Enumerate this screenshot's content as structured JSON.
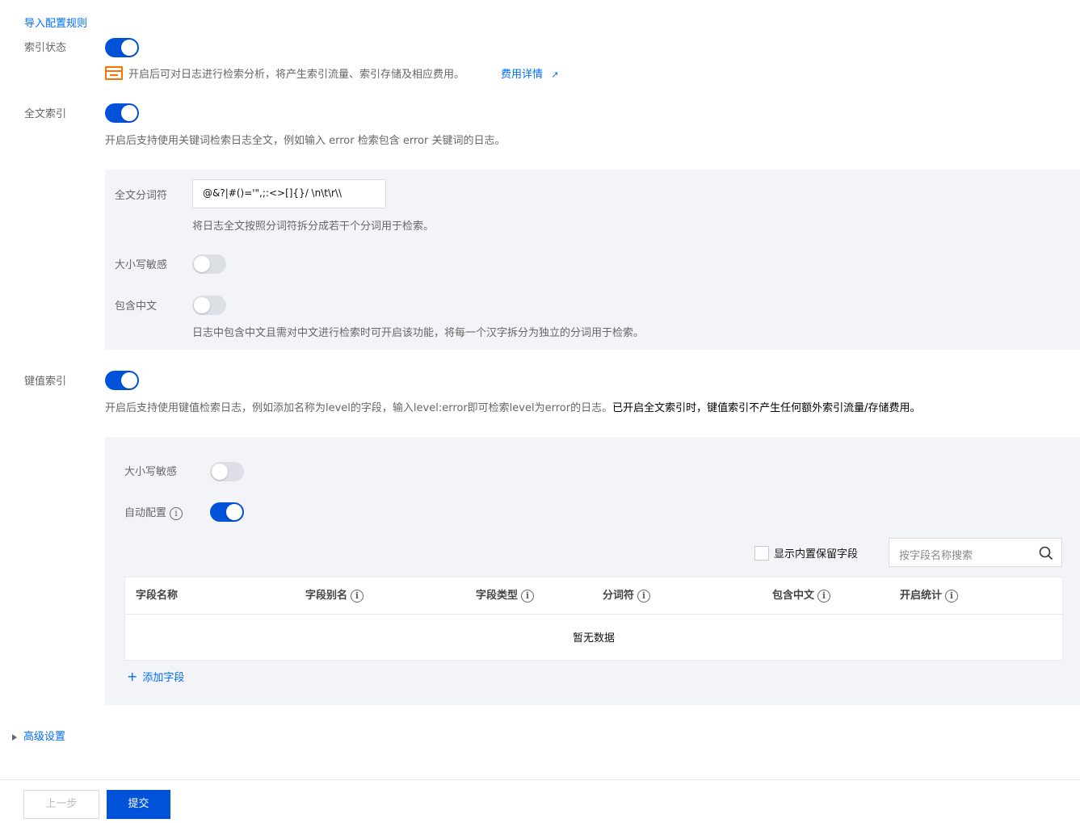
{
  "import_rules_link": "导入配置规则",
  "index_status": {
    "label": "索引状态",
    "enabled": true,
    "notice_text": "开启后可对日志进行检索分析，将产生索引流量、索引存储及相应费用。",
    "fee_link": "费用详情"
  },
  "fulltext_index": {
    "label": "全文索引",
    "enabled": true,
    "desc": "开启后支持使用关键词检索日志全文，例如输入 error 检索包含 error 关键词的日志。",
    "delimiter_label": "全文分词符",
    "delimiter_value": "@&?|#()='\",;:<>[]{}/ \\n\\t\\r\\\\",
    "delimiter_desc": "将日志全文按照分词符拆分成若干个分词用于检索。",
    "case_sensitive_label": "大小写敏感",
    "case_sensitive": false,
    "include_chinese_label": "包含中文",
    "include_chinese": false,
    "include_chinese_desc": "日志中包含中文且需对中文进行检索时可开启该功能，将每一个汉字拆分为独立的分词用于检索。"
  },
  "kv_index": {
    "label": "键值索引",
    "enabled": true,
    "desc_normal": "开启后支持使用键值检索日志，例如添加名称为level的字段，输入level:error即可检索level为error的日志。",
    "desc_bold": "已开启全文索引时，键值索引不产生任何额外索引流量/存储费用。",
    "case_sensitive_label": "大小写敏感",
    "case_sensitive": false,
    "auto_config_label": "自动配置",
    "auto_config": true,
    "show_reserved_label": "显示内置保留字段",
    "search_placeholder": "按字段名称搜索",
    "columns": [
      "字段名称",
      "字段别名",
      "字段类型",
      "分词符",
      "包含中文",
      "开启统计"
    ],
    "empty_text": "暂无数据",
    "add_field": "添加字段"
  },
  "advanced_settings": "高级设置",
  "footer": {
    "prev": "上一步",
    "submit": "提交"
  },
  "colors": {
    "primary": "#0052d9",
    "link": "#006eff",
    "panel_bg": "#f3f4f7",
    "notice_icon": "#ff7200"
  }
}
